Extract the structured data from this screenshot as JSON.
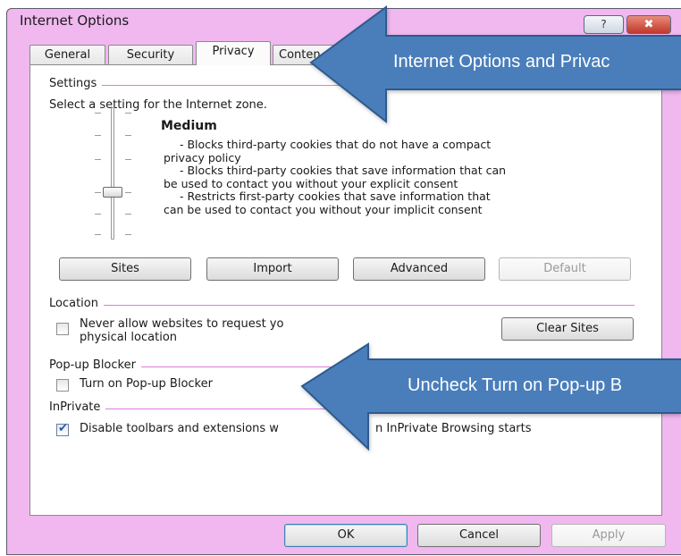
{
  "window": {
    "title": "Internet Options",
    "help_glyph": "?",
    "close_glyph": "✖"
  },
  "tabs": [
    {
      "label": "General"
    },
    {
      "label": "Security"
    },
    {
      "label": "Privacy"
    },
    {
      "label": "Conten"
    }
  ],
  "active_tab": "Privacy",
  "settings": {
    "group_label": "Settings",
    "instruction": "Select a setting for the Internet zone.",
    "level": "Medium",
    "description_lines": [
      "- Blocks third-party cookies that do not have a compact",
      "privacy policy",
      "- Blocks third-party cookies that save information that can",
      "be used to contact you without your explicit consent",
      "- Restricts first-party cookies that save information that",
      "can be used to contact you without your implicit consent"
    ],
    "buttons": {
      "sites": "Sites",
      "import": "Import",
      "advanced": "Advanced",
      "default": "Default"
    }
  },
  "location": {
    "group_label": "Location",
    "checkbox_line1": "Never allow websites to request yo",
    "checkbox_line2": "physical location",
    "clear_sites": "Clear Sites",
    "checked": false
  },
  "popup": {
    "group_label": "Pop-up Blocker",
    "checkbox_label": "Turn on Pop-up Blocker",
    "checked": false
  },
  "inprivate": {
    "group_label": "InPrivate",
    "checkbox_label_start": "Disable toolbars and extensions w",
    "checkbox_label_end": "n InPrivate Browsing starts",
    "checked": true
  },
  "footer": {
    "ok": "OK",
    "cancel": "Cancel",
    "apply": "Apply"
  },
  "annotations": {
    "top_arrow_text": "Internet Options and Privac",
    "bottom_arrow_text": "Uncheck Turn on Pop-up B",
    "arrow_color": "#4a7ebb",
    "arrow_border": "#2e5a8e"
  }
}
